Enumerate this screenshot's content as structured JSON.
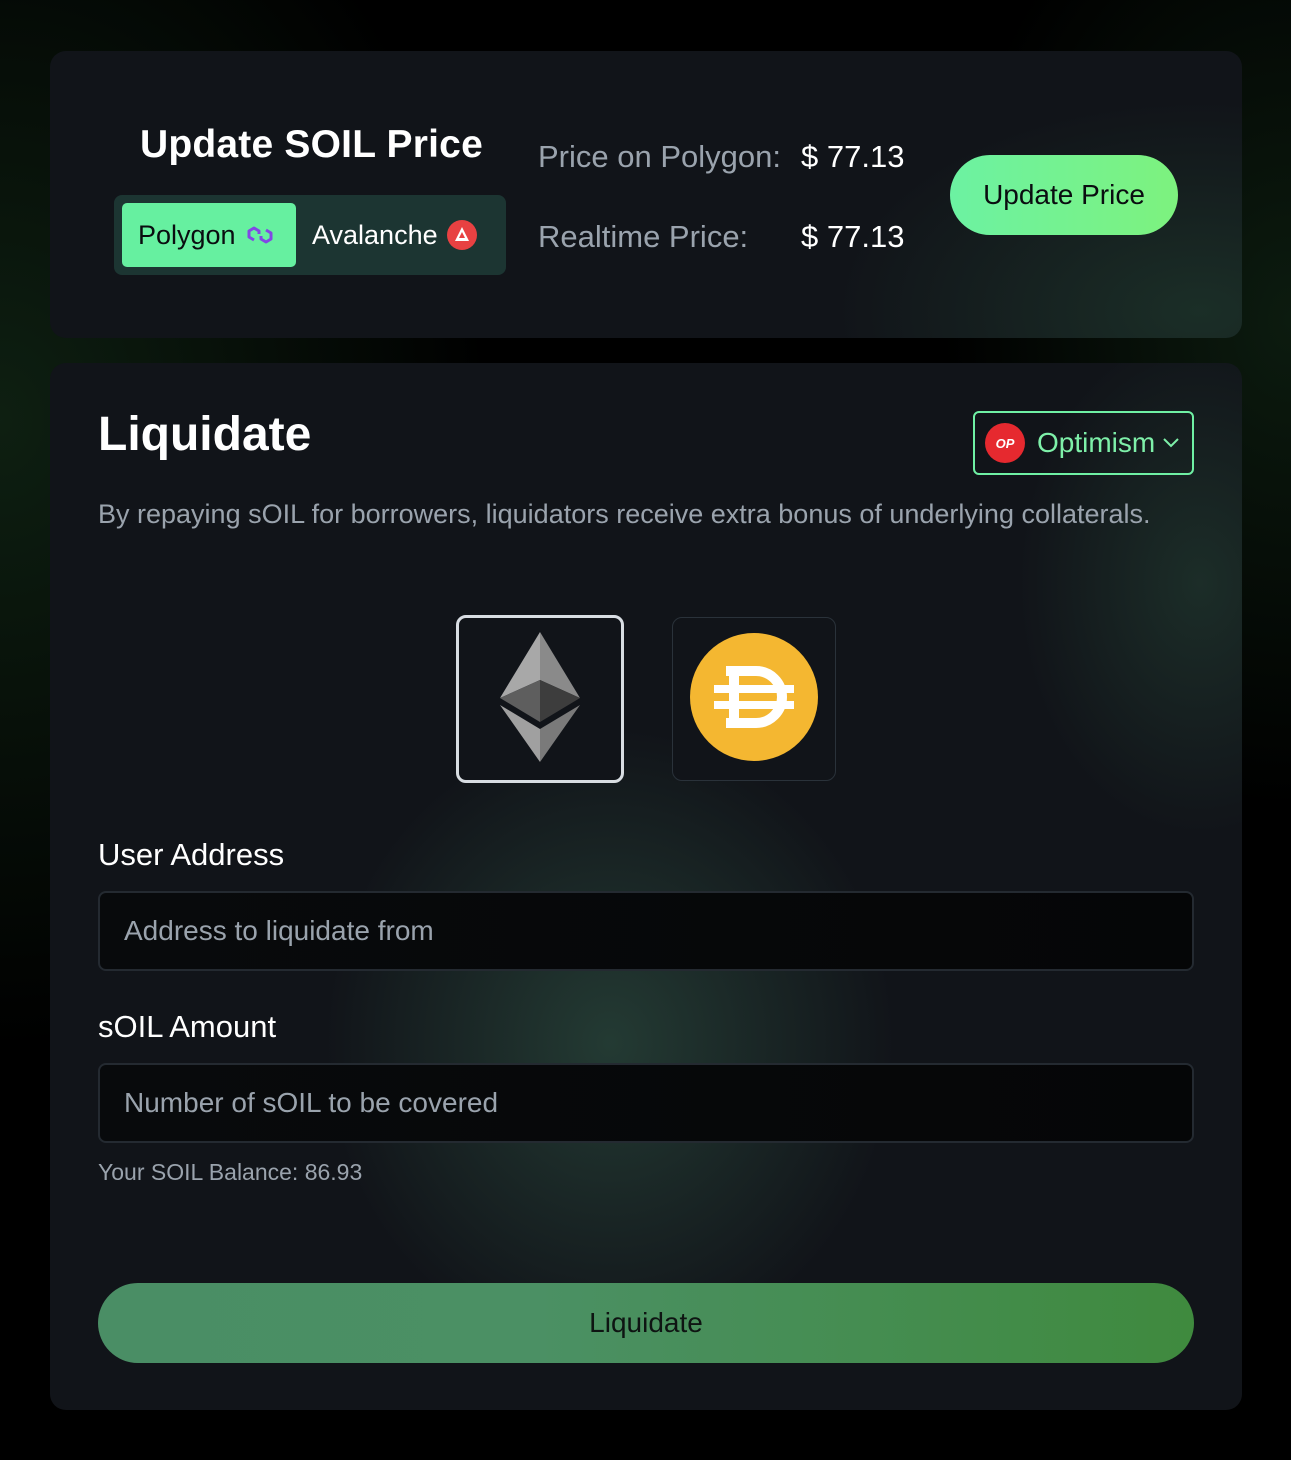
{
  "price_card": {
    "title": "Update SOIL Price",
    "networks": [
      {
        "label": "Polygon",
        "icon": "polygon-icon",
        "active": true
      },
      {
        "label": "Avalanche",
        "icon": "avalanche-icon",
        "active": false
      }
    ],
    "price_on_polygon_label": "Price on Polygon:",
    "price_on_polygon_value": "$ 77.13",
    "realtime_price_label": "Realtime Price:",
    "realtime_price_value": "$ 77.13",
    "update_button": "Update Price"
  },
  "liquidate_card": {
    "title": "Liquidate",
    "chain_select": {
      "badge": "OP",
      "label": "Optimism",
      "icon": "chevron-down-icon"
    },
    "description": "By repaying sOIL for borrowers, liquidators receive extra bonus of underlying collaterals.",
    "assets": [
      {
        "name": "ETH",
        "icon": "ethereum-icon",
        "selected": true
      },
      {
        "name": "DAI",
        "icon": "dai-icon",
        "selected": false
      }
    ],
    "user_address": {
      "label": "User Address",
      "placeholder": "Address to liquidate from",
      "value": ""
    },
    "soil_amount": {
      "label": "sOIL Amount",
      "placeholder": "Number of sOIL to be covered",
      "value": ""
    },
    "balance_text": "Your SOIL Balance: 86.93",
    "submit_button": "Liquidate"
  },
  "colors": {
    "accent": "#66f0a0",
    "card_bg": "#111419",
    "muted_text": "#9aa3ad",
    "op_red": "#e6292f",
    "dai_gold": "#f4b731"
  }
}
